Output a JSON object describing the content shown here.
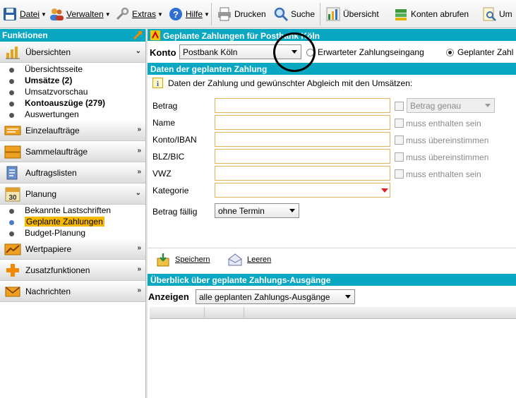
{
  "toolbar": {
    "datei": "Datei",
    "verwalten": "Verwalten",
    "extras": "Extras",
    "hilfe": "Hilfe",
    "drucken": "Drucken",
    "suche": "Suche",
    "uebersicht": "Übersicht",
    "konten_abrufen": "Konten abrufen",
    "truncated": "Um"
  },
  "sidebar": {
    "header": "Funktionen",
    "sections": {
      "uebersichten": "Übersichten",
      "einzelauftraege": "Einzelaufträge",
      "sammelauftraege": "Sammelaufträge",
      "auftragslisten": "Auftragslisten",
      "planung": "Planung",
      "wertpapiere": "Wertpapiere",
      "zusatzfunktionen": "Zusatzfunktionen",
      "nachrichten": "Nachrichten"
    },
    "uebersichten_items": [
      "Übersichtsseite",
      "Umsätze (2)",
      "Umsatzvorschau",
      "Kontoauszüge (279)",
      "Auswertungen"
    ],
    "planung_items": [
      "Bekannte Lastschriften",
      "Geplante Zahlungen",
      "Budget-Planung"
    ],
    "selected_item": "Geplante Zahlungen"
  },
  "main": {
    "title": "Geplante Zahlungen für Postbank Köln",
    "konto_label": "Konto",
    "konto_value": "Postbank Köln",
    "radio_income": "Erwarteter Zahlungseingang",
    "radio_expense": "Geplanter Zahl",
    "radio_selected": "Geplanter Zahl",
    "details_header": "Daten der geplanten Zahlung",
    "info_text": "Daten der Zahlung und gewünschter Abgleich mit den Umsätzen:",
    "fields": {
      "betrag": "Betrag",
      "name": "Name",
      "konto_iban": "Konto/IBAN",
      "blz_bic": "BLZ/BIC",
      "vwz": "VWZ",
      "kategorie": "Kategorie",
      "betrag_faellig": "Betrag fällig"
    },
    "match_options": {
      "betrag_genau": "Betrag genau",
      "name": "muss enthalten sein",
      "konto": "muss übereinstimmen",
      "blz": "muss übereinstimmen",
      "vwz": "muss enthalten sein"
    },
    "faellig_value": "ohne Termin",
    "speichern": "Speichern",
    "leeren": "Leeren",
    "overview_header": "Überblick über geplante Zahlungs-Ausgänge",
    "anzeigen_label": "Anzeigen",
    "anzeigen_value": "alle geplanten Zahlungs-Ausgänge"
  },
  "colors": {
    "accent": "#0aa7c3",
    "selection": "#f6b800",
    "field_border": "#e0b25a"
  }
}
